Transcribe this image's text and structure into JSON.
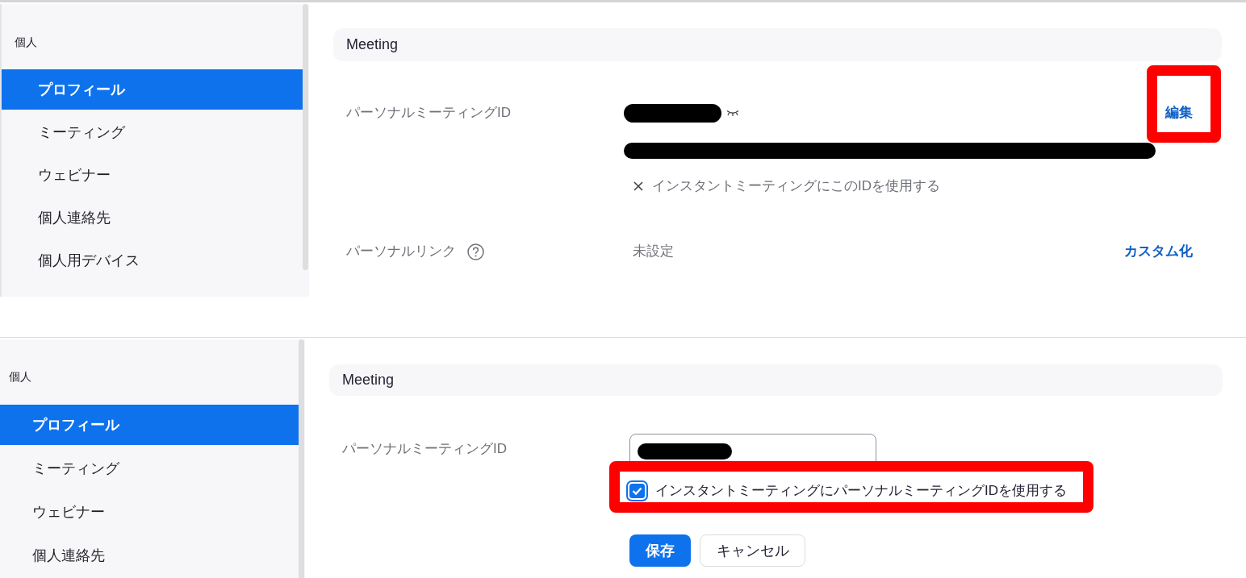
{
  "panels": [
    {
      "sidebar": {
        "heading": "個人",
        "items": [
          {
            "label": "プロフィール",
            "selected": true
          },
          {
            "label": "ミーティング",
            "selected": false
          },
          {
            "label": "ウェビナー",
            "selected": false
          },
          {
            "label": "個人連絡先",
            "selected": false
          },
          {
            "label": "個人用デバイス",
            "selected": false
          }
        ]
      },
      "section": {
        "title": "Meeting",
        "rows": [
          {
            "kind": "id_view",
            "label": "パーソナルミーティングID",
            "instant_option": {
              "label": "インスタントミーティングにこのIDを使用する",
              "enabled": false
            },
            "action": {
              "label": "編集",
              "highlighted": true
            }
          },
          {
            "kind": "link",
            "label": "パーソナルリンク",
            "value": "未設定",
            "action": {
              "label": "カスタム化",
              "highlighted": false
            }
          }
        ]
      }
    },
    {
      "sidebar": {
        "heading": "個人",
        "items": [
          {
            "label": "プロフィール",
            "selected": true
          },
          {
            "label": "ミーティング",
            "selected": false
          },
          {
            "label": "ウェビナー",
            "selected": false
          },
          {
            "label": "個人連絡先",
            "selected": false
          }
        ]
      },
      "section": {
        "title": "Meeting",
        "rows": [
          {
            "kind": "id_edit",
            "label": "パーソナルミーティングID",
            "instant_option": {
              "label": "インスタントミーティングにパーソナルミーティングIDを使用する",
              "checked": true,
              "highlighted": true
            },
            "buttons": [
              {
                "label": "保存",
                "kind": "primary"
              },
              {
                "label": "キャンセル",
                "kind": "secondary"
              }
            ]
          }
        ]
      }
    }
  ]
}
